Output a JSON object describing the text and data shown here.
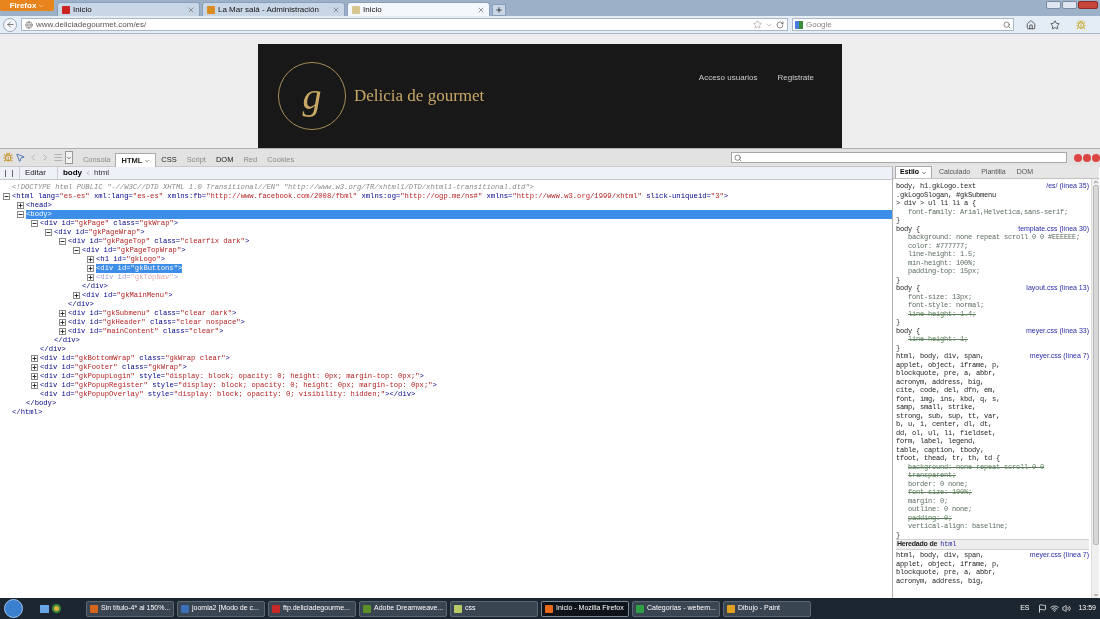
{
  "browser": {
    "menu_button": "Firefox",
    "tabs": [
      {
        "title": "Inicio",
        "selected": false,
        "color": "#cc2222"
      },
      {
        "title": "La Mar salá - Administración",
        "selected": false,
        "color": "#d98c1f"
      },
      {
        "title": "Inicio",
        "selected": true,
        "color": "#d8c690"
      }
    ],
    "url": "www.deliciadegourmet.com/es/",
    "search_placeholder": "Google"
  },
  "site": {
    "monogram": "g",
    "title": "Delicia de gourmet",
    "nav": [
      "Acceso usuarios",
      "Registrate"
    ]
  },
  "devtools": {
    "tabs": [
      {
        "label": "Consola",
        "selected": false,
        "disabled": true
      },
      {
        "label": "HTML",
        "selected": true,
        "disabled": false
      },
      {
        "label": "CSS",
        "selected": false,
        "disabled": false
      },
      {
        "label": "Script",
        "selected": false,
        "disabled": true
      },
      {
        "label": "DOM",
        "selected": false,
        "disabled": false
      },
      {
        "label": "Red",
        "selected": false,
        "disabled": true
      },
      {
        "label": "Cookies",
        "selected": false,
        "disabled": true
      }
    ],
    "edit_button": "Editar",
    "breadcrumbs": [
      {
        "label": "body",
        "selected": true
      },
      {
        "label": "html",
        "selected": false
      }
    ],
    "html_tree": [
      {
        "line": [
          {
            "kind": "doc",
            "text": "<!DOCTYPE html PUBLIC \"-//W3C//DTD XHTML 1.0 Transitional//EN\" \"http://www.w3.org/TR/xhtml1/DTD/xhtml1-transitional.dtd\">"
          }
        ],
        "selected": false
      },
      {
        "line": [
          {
            "kind": "tag",
            "text": "<html"
          },
          {
            "kind": "attr",
            "text": " lang="
          },
          {
            "kind": "val",
            "text": "\"es-es\""
          },
          {
            "kind": "attr",
            "text": " xml:lang="
          },
          {
            "kind": "val",
            "text": "\"es-es\""
          },
          {
            "kind": "attr",
            "text": " xmlns:fb="
          },
          {
            "kind": "val",
            "text": "\"http://www.facebook.com/2008/fbml\""
          },
          {
            "kind": "attr",
            "text": " xmlns:og="
          },
          {
            "kind": "val",
            "text": "\"http://ogp.me/ns#\""
          },
          {
            "kind": "attr",
            "text": " xmlns="
          },
          {
            "kind": "val",
            "text": "\"http://www.w3.org/1999/xhtml\""
          },
          {
            "kind": "attr",
            "text": " slick-uniqueid="
          },
          {
            "kind": "val",
            "text": "\"3\""
          },
          {
            "kind": "tag",
            "text": ">"
          }
        ],
        "expanded": true,
        "selected": false,
        "close": [
          {
            "kind": "tag",
            "text": "</html>"
          }
        ],
        "children": [
          {
            "line": [
              {
                "kind": "tag",
                "text": "<head>"
              }
            ],
            "expanded": false,
            "selected": false
          },
          {
            "line": [
              {
                "kind": "tag",
                "text": "<body>"
              }
            ],
            "expanded": true,
            "selected": true,
            "close": [
              {
                "kind": "tag",
                "text": "</body>"
              }
            ],
            "children": [
              {
                "line": [
                  {
                    "kind": "tag",
                    "text": "<div"
                  },
                  {
                    "kind": "attr",
                    "text": " id="
                  },
                  {
                    "kind": "val",
                    "text": "\"gkPage\""
                  },
                  {
                    "kind": "attr",
                    "text": " class="
                  },
                  {
                    "kind": "val",
                    "text": "\"gkWrap\""
                  },
                  {
                    "kind": "tag",
                    "text": ">"
                  }
                ],
                "expanded": true,
                "selected": false,
                "close": [
                  {
                    "kind": "tag",
                    "text": "</div>"
                  }
                ],
                "children": [
                  {
                    "line": [
                      {
                        "kind": "tag",
                        "text": "<div"
                      },
                      {
                        "kind": "attr",
                        "text": " id="
                      },
                      {
                        "kind": "val",
                        "text": "\"gkPageWrap\""
                      },
                      {
                        "kind": "tag",
                        "text": ">"
                      }
                    ],
                    "expanded": true,
                    "selected": false,
                    "close": [
                      {
                        "kind": "tag",
                        "text": "</div>"
                      }
                    ],
                    "children": [
                      {
                        "line": [
                          {
                            "kind": "tag",
                            "text": "<div"
                          },
                          {
                            "kind": "attr",
                            "text": " id="
                          },
                          {
                            "kind": "val",
                            "text": "\"gkPageTop\""
                          },
                          {
                            "kind": "attr",
                            "text": " class="
                          },
                          {
                            "kind": "val",
                            "text": "\"clearfix dark\""
                          },
                          {
                            "kind": "tag",
                            "text": ">"
                          }
                        ],
                        "expanded": true,
                        "selected": false,
                        "close": [
                          {
                            "kind": "tag",
                            "text": "</div>"
                          }
                        ],
                        "children": [
                          {
                            "line": [
                              {
                                "kind": "tag",
                                "text": "<div"
                              },
                              {
                                "kind": "attr",
                                "text": " id="
                              },
                              {
                                "kind": "val",
                                "text": "\"gkPageTopWrap\""
                              },
                              {
                                "kind": "tag",
                                "text": ">"
                              }
                            ],
                            "expanded": true,
                            "selected": false,
                            "close": [
                              {
                                "kind": "tag",
                                "text": "</div>"
                              }
                            ],
                            "children": [
                              {
                                "line": [
                                  {
                                    "kind": "tag",
                                    "text": "<h1"
                                  },
                                  {
                                    "kind": "attr",
                                    "text": " id="
                                  },
                                  {
                                    "kind": "val",
                                    "text": "\"gkLogo\""
                                  },
                                  {
                                    "kind": "tag",
                                    "text": ">"
                                  }
                                ],
                                "expanded": false,
                                "selected": false
                              },
                              {
                                "line": [
                                  {
                                    "kind": "tag",
                                    "text": "<div"
                                  },
                                  {
                                    "kind": "attr",
                                    "text": " id="
                                  },
                                  {
                                    "kind": "val",
                                    "text": "\"gkButtons\""
                                  },
                                  {
                                    "kind": "tag",
                                    "text": ">"
                                  }
                                ],
                                "expanded": false,
                                "selected": false,
                                "highlighted": true
                              },
                              {
                                "line": [
                                  {
                                    "kind": "tag",
                                    "text": "<div"
                                  },
                                  {
                                    "kind": "attr",
                                    "text": " id="
                                  },
                                  {
                                    "kind": "val",
                                    "text": "\"gkTopNav\""
                                  },
                                  {
                                    "kind": "tag",
                                    "text": ">"
                                  }
                                ],
                                "expanded": false,
                                "selected": false,
                                "dimmed": true
                              }
                            ]
                          },
                          {
                            "line": [
                              {
                                "kind": "tag",
                                "text": "<div"
                              },
                              {
                                "kind": "attr",
                                "text": " id="
                              },
                              {
                                "kind": "val",
                                "text": "\"gkMainMenu\""
                              },
                              {
                                "kind": "tag",
                                "text": ">"
                              }
                            ],
                            "expanded": false,
                            "selected": false
                          }
                        ]
                      },
                      {
                        "line": [
                          {
                            "kind": "tag",
                            "text": "<div"
                          },
                          {
                            "kind": "attr",
                            "text": " id="
                          },
                          {
                            "kind": "val",
                            "text": "\"gkSubmenu\""
                          },
                          {
                            "kind": "attr",
                            "text": " class="
                          },
                          {
                            "kind": "val",
                            "text": "\"clear dark\""
                          },
                          {
                            "kind": "tag",
                            "text": ">"
                          }
                        ],
                        "expanded": false,
                        "selected": false
                      },
                      {
                        "line": [
                          {
                            "kind": "tag",
                            "text": "<div"
                          },
                          {
                            "kind": "attr",
                            "text": " id="
                          },
                          {
                            "kind": "val",
                            "text": "\"gkHeader\""
                          },
                          {
                            "kind": "attr",
                            "text": " class="
                          },
                          {
                            "kind": "val",
                            "text": "\"clear nospace\""
                          },
                          {
                            "kind": "tag",
                            "text": ">"
                          }
                        ],
                        "expanded": false,
                        "selected": false
                      },
                      {
                        "line": [
                          {
                            "kind": "tag",
                            "text": "<div"
                          },
                          {
                            "kind": "attr",
                            "text": " id="
                          },
                          {
                            "kind": "val",
                            "text": "\"mainContent\""
                          },
                          {
                            "kind": "attr",
                            "text": " class="
                          },
                          {
                            "kind": "val",
                            "text": "\"clear\""
                          },
                          {
                            "kind": "tag",
                            "text": ">"
                          }
                        ],
                        "expanded": false,
                        "selected": false
                      }
                    ]
                  }
                ]
              },
              {
                "line": [
                  {
                    "kind": "tag",
                    "text": "<div"
                  },
                  {
                    "kind": "attr",
                    "text": " id="
                  },
                  {
                    "kind": "val",
                    "text": "\"gkBottomWrap\""
                  },
                  {
                    "kind": "attr",
                    "text": " class="
                  },
                  {
                    "kind": "val",
                    "text": "\"gkWrap clear\""
                  },
                  {
                    "kind": "tag",
                    "text": ">"
                  }
                ],
                "expanded": false,
                "selected": false
              },
              {
                "line": [
                  {
                    "kind": "tag",
                    "text": "<div"
                  },
                  {
                    "kind": "attr",
                    "text": " id="
                  },
                  {
                    "kind": "val",
                    "text": "\"gkFooter\""
                  },
                  {
                    "kind": "attr",
                    "text": " class="
                  },
                  {
                    "kind": "val",
                    "text": "\"gkWrap\""
                  },
                  {
                    "kind": "tag",
                    "text": ">"
                  }
                ],
                "expanded": false,
                "selected": false
              },
              {
                "line": [
                  {
                    "kind": "tag",
                    "text": "<div"
                  },
                  {
                    "kind": "attr",
                    "text": " id="
                  },
                  {
                    "kind": "val",
                    "text": "\"gkPopupLogin\""
                  },
                  {
                    "kind": "attr",
                    "text": " style="
                  },
                  {
                    "kind": "val",
                    "text": "\"display: block; opacity: 0; height: 0px; margin-top: 0px;\""
                  },
                  {
                    "kind": "tag",
                    "text": ">"
                  }
                ],
                "expanded": false,
                "selected": false
              },
              {
                "line": [
                  {
                    "kind": "tag",
                    "text": "<div"
                  },
                  {
                    "kind": "attr",
                    "text": " id="
                  },
                  {
                    "kind": "val",
                    "text": "\"gkPopupRegister\""
                  },
                  {
                    "kind": "attr",
                    "text": " style="
                  },
                  {
                    "kind": "val",
                    "text": "\"display: block; opacity: 0; height: 0px; margin-top: 0px;\""
                  },
                  {
                    "kind": "tag",
                    "text": ">"
                  }
                ],
                "expanded": false,
                "selected": false
              },
              {
                "line": [
                  {
                    "kind": "tag",
                    "text": "<div"
                  },
                  {
                    "kind": "attr",
                    "text": " id="
                  },
                  {
                    "kind": "val",
                    "text": "\"gkPopupOverlay\""
                  },
                  {
                    "kind": "attr",
                    "text": " style="
                  },
                  {
                    "kind": "val",
                    "text": "\"display: block; opacity: 0; visibility: hidden;\""
                  },
                  {
                    "kind": "tag",
                    "text": ">"
                  },
                  {
                    "kind": "tag",
                    "text": "</div>"
                  }
                ],
                "selected": false
              }
            ]
          }
        ]
      }
    ],
    "style_tabs": [
      {
        "label": "Estilo",
        "selected": true,
        "dropdown": true
      },
      {
        "label": "Calculado",
        "selected": false,
        "dropdown": false
      },
      {
        "label": "Plantilla",
        "selected": false,
        "dropdown": false
      },
      {
        "label": "DOM",
        "selected": false,
        "dropdown": false
      }
    ],
    "rules": [
      {
        "selector": [
          "body, h1.gkLogo.text",
          ".gkLogoSlogan, #gkSubmenu",
          "> div > ul li li a {"
        ],
        "source": "/es/ (línea 35)",
        "props": [
          {
            "text": "font-family: Arial,Helvetica,sans-serif;",
            "overridden": false
          }
        ],
        "close": "}"
      },
      {
        "selector": [
          "body {"
        ],
        "source": "template.css (línea 30)",
        "props": [
          {
            "text": "background: none repeat scroll 0 0 #EEEEEE;",
            "overridden": false
          },
          {
            "text": "color: #777777;",
            "overridden": false
          },
          {
            "text": "line-height: 1.5;",
            "overridden": false
          },
          {
            "text": "min-height: 100%;",
            "overridden": false
          },
          {
            "text": "padding-top: 15px;",
            "overridden": false
          }
        ],
        "close": "}"
      },
      {
        "selector": [
          "body {"
        ],
        "source": "layout.css (línea 13)",
        "props": [
          {
            "text": "font-size: 13px;",
            "overridden": false
          },
          {
            "text": "font-style: normal;",
            "overridden": false
          },
          {
            "text": "line-height: 1.4;",
            "overridden": true
          }
        ],
        "close": "}"
      },
      {
        "selector": [
          "body {"
        ],
        "source": "meyer.css (línea 33)",
        "props": [
          {
            "text": "line-height: 1;",
            "overridden": true
          }
        ],
        "close": "}"
      },
      {
        "selector": [
          "html, body, div, span,",
          "applet, object, iframe, p,",
          "blockquote, pre, a, abbr,",
          "acronym, address, big,",
          "cite, code, del, dfn, em,",
          "font, img, ins, kbd, q, s,",
          "samp, small, strike,",
          "strong, sub, sup, tt, var,",
          "b, u, i, center, dl, dt,",
          "dd, ol, ul, li, fieldset,",
          "form, label, legend,",
          "table, caption, tbody,",
          "tfoot, thead, tr, th, td {"
        ],
        "source": "meyer.css (línea 7)",
        "props": [
          {
            "text": "background: none repeat scroll 0 0 transparent;",
            "overridden": true
          },
          {
            "text": "border: 0 none;",
            "overridden": false
          },
          {
            "text": "font-size: 100%;",
            "overridden": true
          },
          {
            "text": "margin: 0;",
            "overridden": false
          },
          {
            "text": "outline: 0 none;",
            "overridden": false
          },
          {
            "text": "padding: 0;",
            "overridden": true
          },
          {
            "text": "vertical-align: baseline;",
            "overridden": false
          }
        ],
        "close": "}"
      }
    ],
    "inherited": {
      "label": "Heredado de",
      "element": "html"
    },
    "inherited_rules": [
      {
        "selector": [
          "html, body, div, span,",
          "applet, object, iframe, p,",
          "blockquote, pre, a, abbr,",
          "acronym, address, big,"
        ],
        "source": "meyer.css (línea 7)"
      }
    ]
  },
  "taskbar": {
    "items": [
      {
        "label": "Sin título-4* al 150%...",
        "selected": false,
        "color": "#d4661c"
      },
      {
        "label": "joomla2 [Modo de c...",
        "selected": false,
        "color": "#3d6fb6"
      },
      {
        "label": "ftp.deliciadegourme...",
        "selected": false,
        "color": "#c62828"
      },
      {
        "label": "Adobe Dreamweave...",
        "selected": false,
        "color": "#5a8f2a"
      },
      {
        "label": "css",
        "selected": false,
        "color": "#b8c968"
      },
      {
        "label": "Inicio - Mozilla Firefox",
        "selected": true,
        "color": "#e66a1a"
      },
      {
        "label": "Categorías - webem...",
        "selected": false,
        "color": "#2f9e44"
      },
      {
        "label": "Dibujo - Paint",
        "selected": false,
        "color": "#e0a020"
      }
    ],
    "language": "ES",
    "clock": "13:59"
  }
}
